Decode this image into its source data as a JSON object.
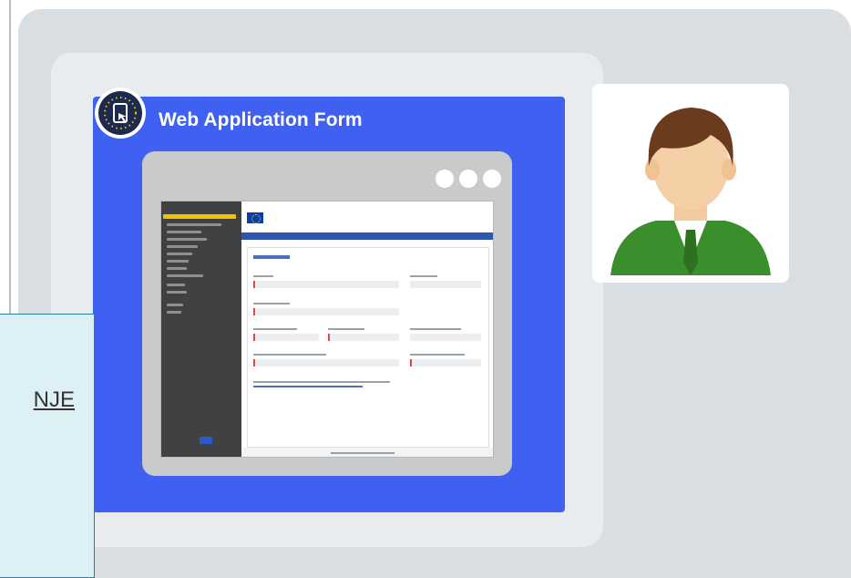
{
  "card": {
    "title": "Web Application Form"
  },
  "icons": {
    "logo": "erasmus-web-form-logo-icon",
    "window_dots": [
      "window-dot-icon",
      "window-dot-icon",
      "window-dot-icon"
    ],
    "avatar": "person-avatar-icon"
  },
  "overlay": {
    "link_text": "NJE"
  },
  "colors": {
    "card_blue": "#3f60f0",
    "panel_grey": "#d9dee2",
    "avatar_jacket": "#3a8f2c",
    "overlay_bg": "#ddf0f5",
    "overlay_border": "#2a7ca0"
  }
}
